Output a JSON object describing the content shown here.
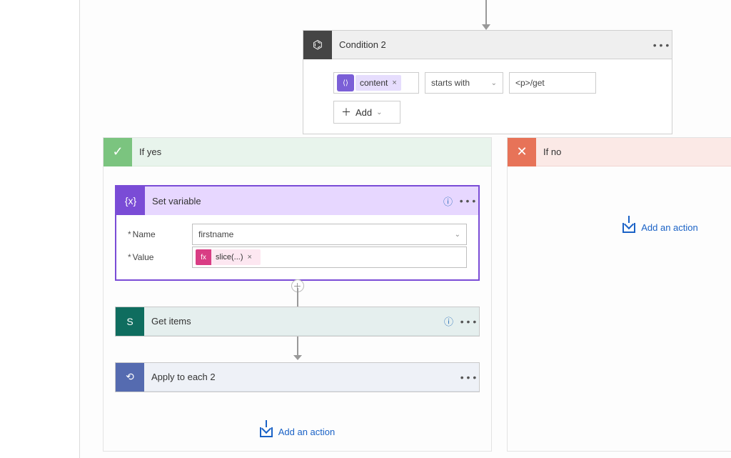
{
  "arrow_top": {
    "height": "30"
  },
  "condition": {
    "title": "Condition 2",
    "token_label": "content",
    "operator": "starts with",
    "value": "<p>/get",
    "add_label": "Add"
  },
  "branches": {
    "yes": {
      "label": "If yes",
      "glyph": "✓"
    },
    "no": {
      "label": "If no",
      "glyph": "✕"
    }
  },
  "actions": {
    "set_variable": {
      "title": "Set variable",
      "name_label": "Name",
      "value_label": "Value",
      "name_value": "firstname",
      "fx_label": "slice(...)",
      "fx_icon": "fx"
    },
    "get_items": {
      "title": "Get items",
      "icon_letter": "S"
    },
    "apply_each": {
      "title": "Apply to each 2"
    }
  },
  "add_action_label": "Add an action",
  "glyphs": {
    "remove_x": "×",
    "chevron_down": "⌄",
    "ellipsis": "• • •",
    "help": "?",
    "plus": "＋",
    "brace": "{x}",
    "loop": "⟲",
    "org": "⌬"
  }
}
